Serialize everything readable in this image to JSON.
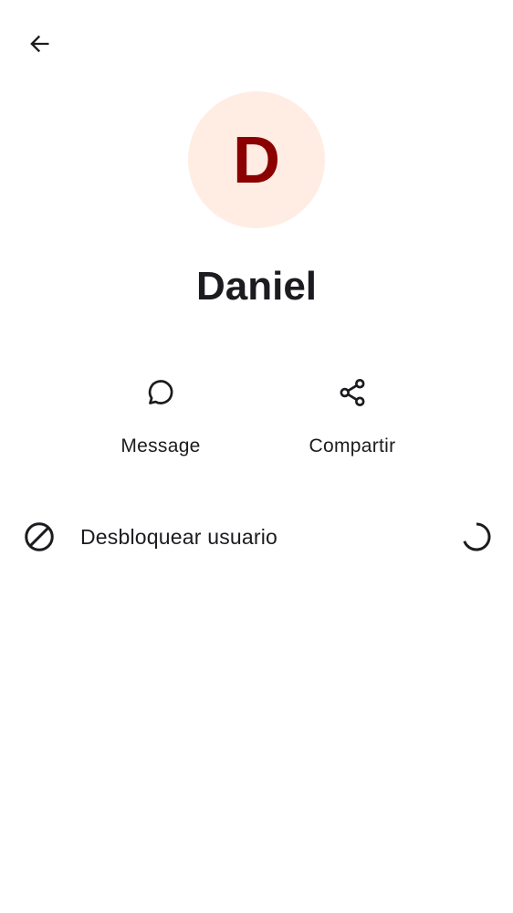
{
  "header": {
    "back_icon": "arrow-back-icon"
  },
  "profile": {
    "avatar_initial": "D",
    "avatar_bg": "#ffede4",
    "avatar_fg": "#8b0000",
    "name": "Daniel"
  },
  "actions": [
    {
      "label": "Message",
      "icon": "chat-bubble-icon"
    },
    {
      "label": "Compartir",
      "icon": "share-icon"
    }
  ],
  "options": [
    {
      "label": "Desbloquear usuario",
      "icon": "block-icon",
      "status_icon": "loading-spinner-icon"
    }
  ]
}
